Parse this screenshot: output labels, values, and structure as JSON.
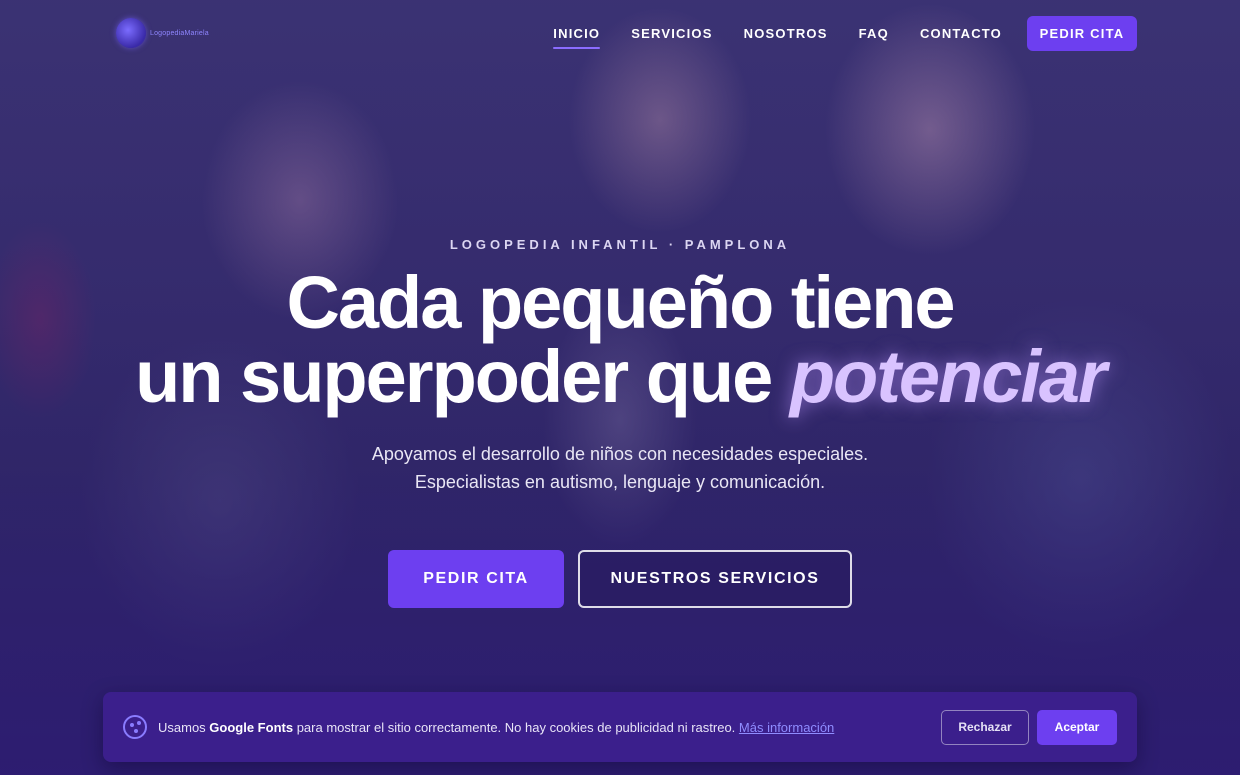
{
  "brand": {
    "logo_icon": "brain-logo-icon",
    "logo_text": "LogopediaMariela"
  },
  "nav": {
    "items": [
      {
        "label": "INICIO",
        "active": true
      },
      {
        "label": "SERVICIOS",
        "active": false
      },
      {
        "label": "NOSOTROS",
        "active": false
      },
      {
        "label": "FAQ",
        "active": false
      },
      {
        "label": "CONTACTO",
        "active": false
      }
    ],
    "cta_label": "PEDIR CITA"
  },
  "hero": {
    "eyebrow": "LOGOPEDIA INFANTIL · PAMPLONA",
    "headline_line1": "Cada pequeño tiene",
    "headline_line2_prefix": "un superpoder que ",
    "headline_accent": "potenciar",
    "subtitle_line1": "Apoyamos el desarrollo de niños con necesidades especiales.",
    "subtitle_line2": "Especialistas en autismo, lenguaje y comunicación.",
    "primary_cta": "PEDIR CITA",
    "secondary_cta": "NUESTROS SERVICIOS"
  },
  "cookie_banner": {
    "icon": "cookie-icon",
    "text_prefix": "Usamos ",
    "text_bold": "Google Fonts",
    "text_suffix": " para mostrar el sitio correctamente. No hay cookies de publicidad ni rastreo. ",
    "link_label": "Más información",
    "reject_label": "Rechazar",
    "accept_label": "Aceptar"
  },
  "colors": {
    "accent": "#6d3ff0",
    "headline_accent": "#d9c3ff",
    "banner_bg": "#3b1f8c"
  }
}
